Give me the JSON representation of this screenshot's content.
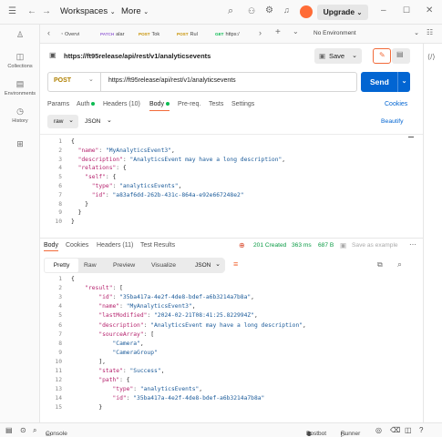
{
  "header": {
    "workspaces": "Workspaces",
    "more": "More",
    "upgrade": "Upgrade"
  },
  "sidebar": {
    "items": [
      {
        "label": ""
      },
      {
        "label": "Collections"
      },
      {
        "label": "Environments"
      },
      {
        "label": "History"
      },
      {
        "label": ""
      }
    ]
  },
  "tabs": [
    {
      "method": "",
      "label": "Overvi"
    },
    {
      "method": "PATCH",
      "label": "alar"
    },
    {
      "method": "POST",
      "label": "Tok"
    },
    {
      "method": "POST",
      "label": "Rul"
    },
    {
      "method": "GET",
      "label": "https:/"
    }
  ],
  "environment": "No Environment",
  "request": {
    "title": "https://ft95release/api/rest/v1/analyticsevents",
    "save_label": "Save",
    "method": "POST",
    "url": "https://ft95release/api/rest/v1/analyticsevents",
    "send_label": "Send",
    "tabs": [
      "Params",
      "Auth",
      "Headers (10)",
      "Body",
      "Pre-req.",
      "Tests",
      "Settings"
    ],
    "cookies_label": "Cookies",
    "body_mode": "raw",
    "body_lang": "JSON",
    "beautify_label": "Beautify",
    "body_lines": [
      {
        "n": "1",
        "t": "{"
      },
      {
        "n": "2",
        "t": "  \"name\": \"MyAnalyticsEvent3\","
      },
      {
        "n": "3",
        "t": "  \"description\": \"AnalyticsEvent may have a long description\","
      },
      {
        "n": "4",
        "t": "  \"relations\": {"
      },
      {
        "n": "5",
        "t": "    \"self\": {"
      },
      {
        "n": "6",
        "t": "      \"type\": \"analyticsEvents\","
      },
      {
        "n": "7",
        "t": "      \"id\": \"a83af6dd-262b-431c-864a-e92e667248e2\""
      },
      {
        "n": "8",
        "t": "    }"
      },
      {
        "n": "9",
        "t": "  }"
      },
      {
        "n": "10",
        "t": "}"
      }
    ]
  },
  "response": {
    "tabs": [
      "Body",
      "Cookies",
      "Headers (11)",
      "Test Results"
    ],
    "status": "201 Created",
    "time": "363 ms",
    "size": "687 B",
    "save_example": "Save as example",
    "view_modes": [
      "Pretty",
      "Raw",
      "Preview",
      "Visualize"
    ],
    "lang": "JSON",
    "body_lines": [
      {
        "n": "1",
        "t": "{"
      },
      {
        "n": "2",
        "t": "    \"result\": ["
      },
      {
        "n": "3",
        "t": "        \"id\": \"35ba417a-4e2f-4de8-bdef-a6b3214a7b8a\","
      },
      {
        "n": "4",
        "t": "        \"name\": \"MyAnalyticsEvent3\","
      },
      {
        "n": "5",
        "t": "        \"lastModified\": \"2024-02-21T08:41:25.822994Z\","
      },
      {
        "n": "6",
        "t": "        \"description\": \"AnalyticsEvent may have a long description\","
      },
      {
        "n": "7",
        "t": "        \"sourceArray\": ["
      },
      {
        "n": "8",
        "t": "            \"Camera\","
      },
      {
        "n": "9",
        "t": "            \"CameraGroup\""
      },
      {
        "n": "10",
        "t": "        ],"
      },
      {
        "n": "11",
        "t": "        \"state\": \"Success\","
      },
      {
        "n": "12",
        "t": "        \"path\": {"
      },
      {
        "n": "13",
        "t": "            \"type\": \"analyticsEvents\","
      },
      {
        "n": "14",
        "t": "            \"id\": \"35ba417a-4e2f-4de8-bdef-a6b3214a7b8a\""
      },
      {
        "n": "15",
        "t": "        }"
      }
    ]
  },
  "statusbar": {
    "console": "Console",
    "postbot": "Postbot",
    "runner": "Runner"
  },
  "colors": {
    "send": "#0265d2",
    "accent": "#ff6c37",
    "status_ok": "#0cbb52"
  }
}
